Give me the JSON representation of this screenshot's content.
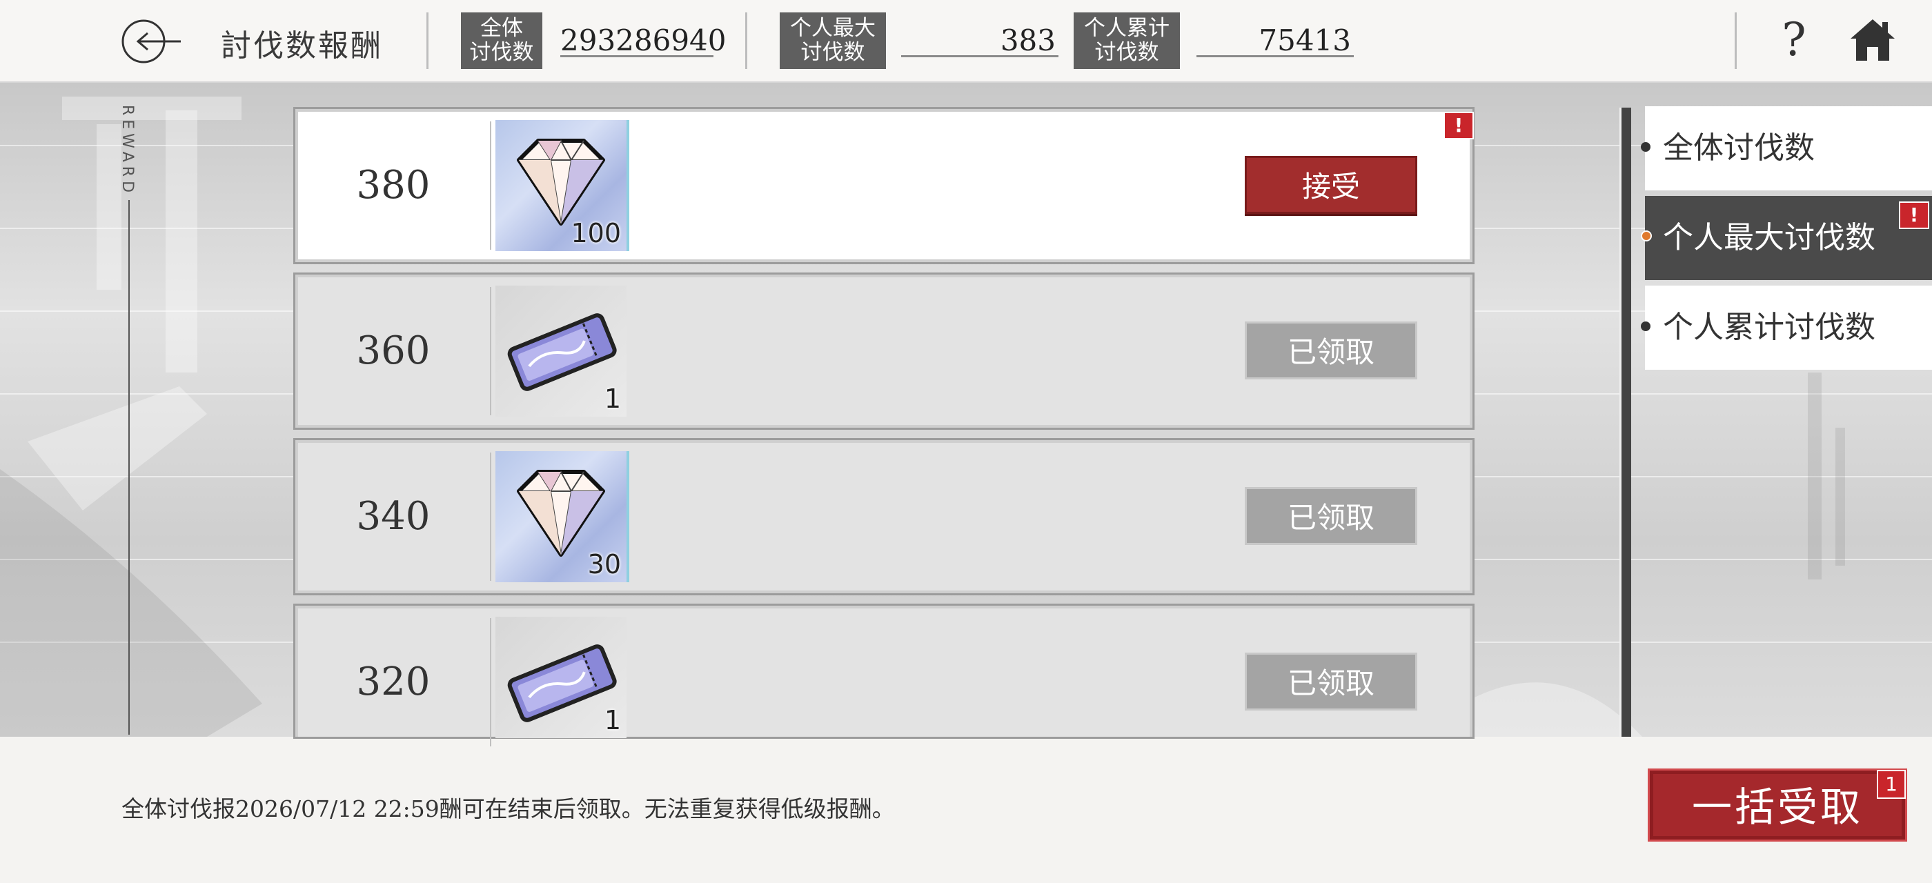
{
  "header": {
    "title": "討伐数報酬",
    "stats": [
      {
        "label_line1": "全体",
        "label_line2": "讨伐数",
        "value": "293286940"
      },
      {
        "label_line1": "个人最大",
        "label_line2": "讨伐数",
        "value": "383"
      },
      {
        "label_line1": "个人累计",
        "label_line2": "讨伐数",
        "value": "75413"
      }
    ],
    "help_label": "?"
  },
  "side_label": "REWARD",
  "rewards": [
    {
      "threshold": "380",
      "item": "gem-icon",
      "quantity": "100",
      "button": "接受",
      "state": "available",
      "alert": "!"
    },
    {
      "threshold": "360",
      "item": "ticket-icon",
      "quantity": "1",
      "button": "已领取",
      "state": "claimed"
    },
    {
      "threshold": "340",
      "item": "gem-icon",
      "quantity": "30",
      "button": "已领取",
      "state": "claimed"
    },
    {
      "threshold": "320",
      "item": "ticket-icon",
      "quantity": "1",
      "button": "已领取",
      "state": "claimed"
    }
  ],
  "tabs": [
    {
      "label": "全体讨伐数",
      "selected": false
    },
    {
      "label": "个人最大讨伐数",
      "selected": true,
      "alert": "!"
    },
    {
      "label": "个人累计讨伐数",
      "selected": false
    }
  ],
  "footer": {
    "notice": "全体讨伐报2026/07/12 22:59酬可在结束后领取。无法重复获得低级报酬。",
    "claim_all_label": "一括受取",
    "claim_all_count": "1"
  },
  "colors": {
    "accent_red": "#a22d2d",
    "alert_red": "#c9252b",
    "tab_selected": "#4a4a4a",
    "claimed_gray": "#a4a4a4",
    "selected_dot": "#e07a2e"
  }
}
